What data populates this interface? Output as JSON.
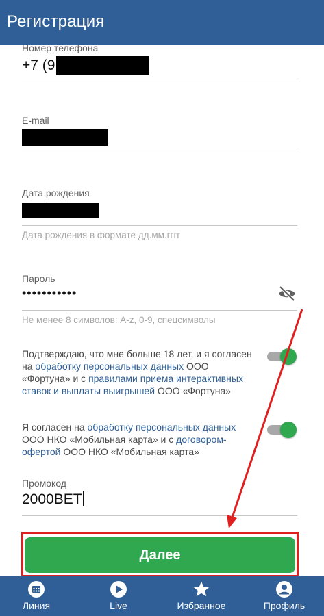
{
  "header": {
    "title": "Регистрация"
  },
  "form": {
    "phone": {
      "label": "Номер телефона",
      "value": "+7 (9"
    },
    "email": {
      "label": "E-mail"
    },
    "birthdate": {
      "label": "Дата рождения",
      "hint": "Дата рождения в формате дд.мм.гггг"
    },
    "password": {
      "label": "Пароль",
      "value": "•••••••••••",
      "hint": "Не менее 8 символов: A-z, 0-9, спецсимволы"
    },
    "consent1": {
      "text1": "Подтверждаю, что мне больше 18 лет, и я согласен на ",
      "link1": "обработку персональных данных",
      "text2": " ООО «Фортуна» и с ",
      "link2": "правилами приема интерактивных ставок и выплаты выигрышей",
      "text3": " ООО «Фортуна»",
      "enabled": true
    },
    "consent2": {
      "text1": "Я согласен на ",
      "link1": "обработку персональных данных",
      "text2": " ООО НКО «Мобильная карта» и с ",
      "link2": "договором-офертой",
      "text3": " ООО НКО «Мобильная карта»",
      "enabled": true
    },
    "promo": {
      "label": "Промокод",
      "value": "2000BET"
    },
    "submit_label": "Далее"
  },
  "bottom_nav": {
    "items": [
      {
        "label": "Линия",
        "icon": "calendar-icon"
      },
      {
        "label": "Live",
        "icon": "play-icon"
      },
      {
        "label": "Избранное",
        "icon": "star-icon"
      },
      {
        "label": "Профиль",
        "icon": "profile-icon"
      }
    ]
  },
  "colors": {
    "primary": "#2f5f96",
    "accent_green": "#2fa84f",
    "highlight_red": "#e01f1f"
  }
}
